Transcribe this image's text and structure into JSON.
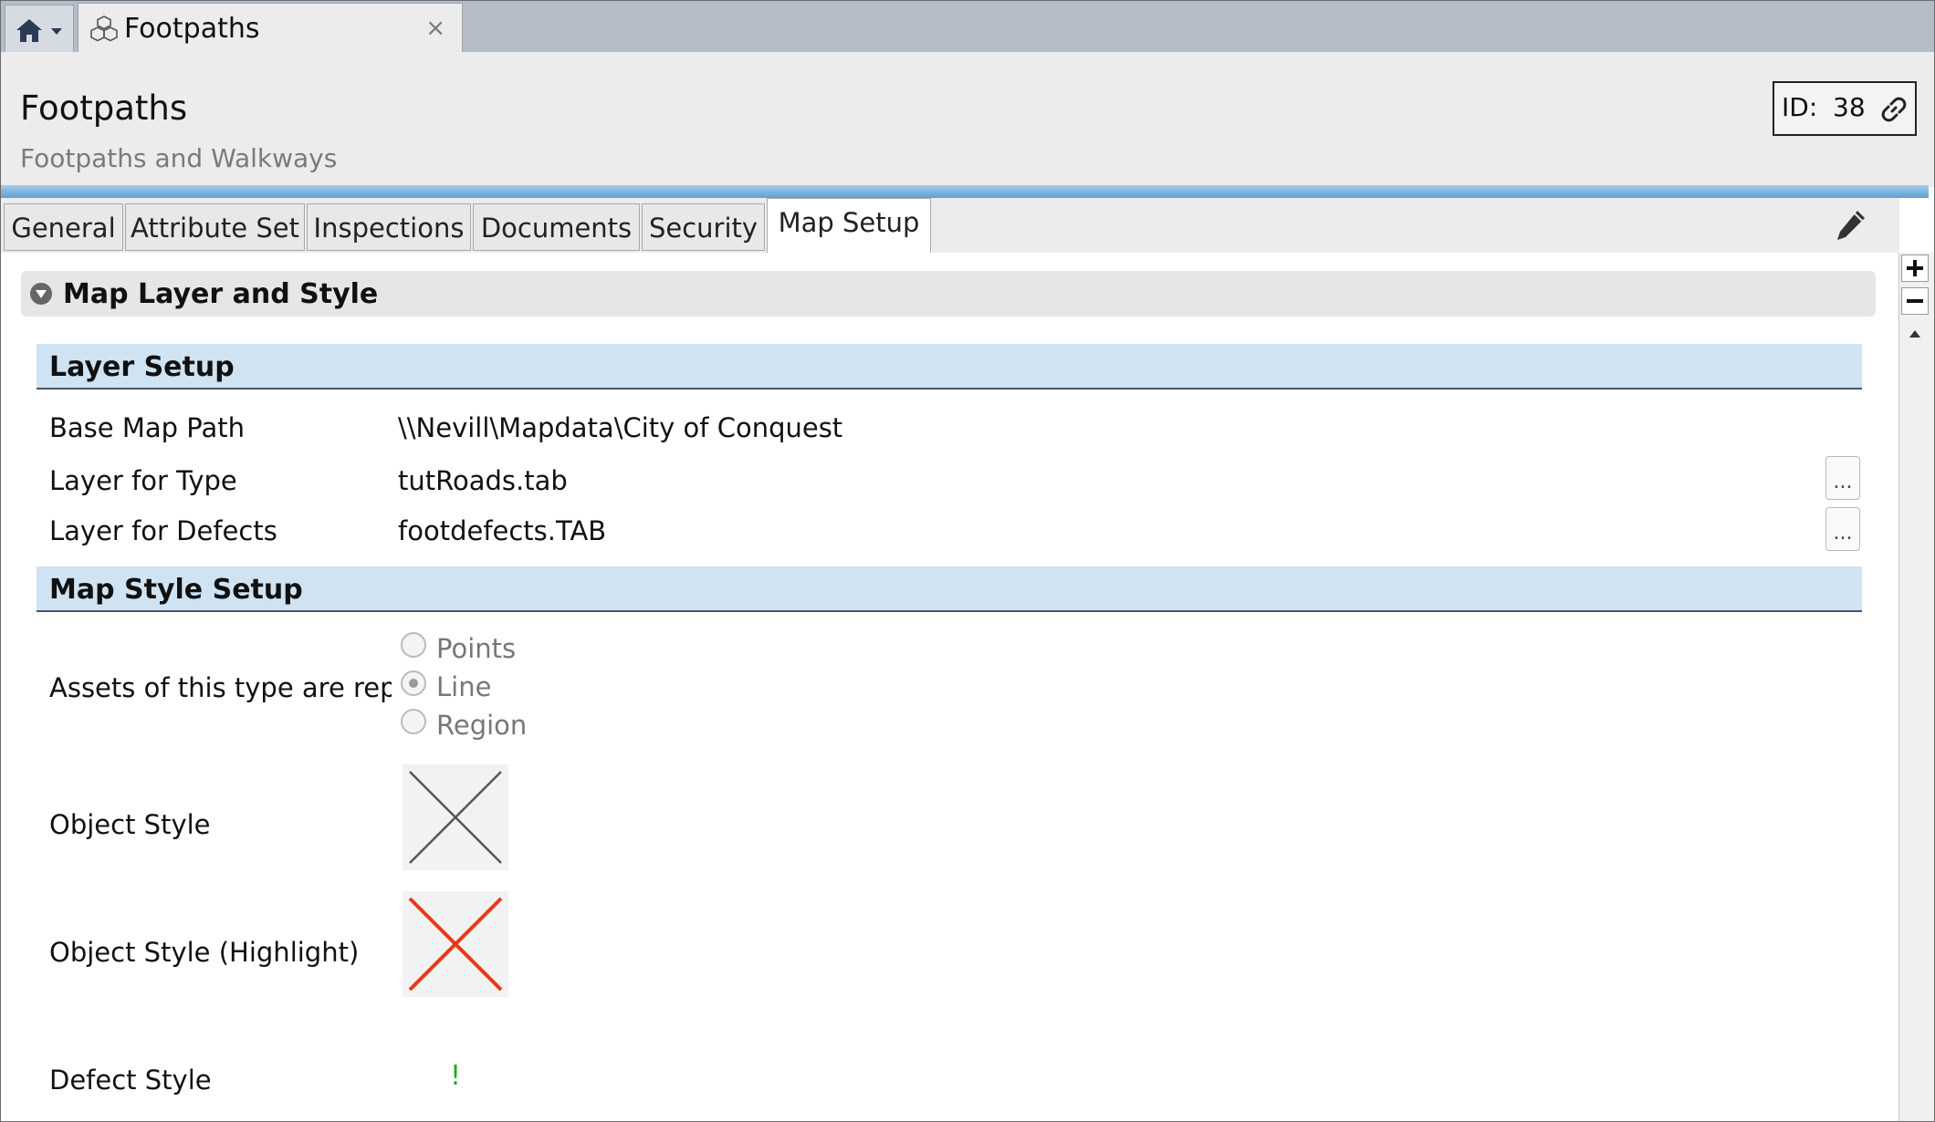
{
  "tab": {
    "title": "Footpaths",
    "close": "×",
    "home_icon": "home-icon",
    "type_icon": "cubes-icon"
  },
  "header": {
    "title": "Footpaths",
    "subtitle": "Footpaths and Walkways",
    "id_label": "ID:",
    "id_value": "38"
  },
  "subtabs": [
    "General",
    "Attribute Set",
    "Inspections",
    "Documents",
    "Security",
    "Map Setup"
  ],
  "active_subtab": "Map Setup",
  "section": {
    "title": "Map Layer and Style"
  },
  "layer_setup": {
    "title": "Layer Setup",
    "base_map_label": "Base Map Path",
    "base_map_value": "\\\\Nevill\\Mapdata\\City of Conquest",
    "layer_type_label": "Layer for Type",
    "layer_type_value": "tutRoads.tab",
    "layer_defects_label": "Layer for Defects",
    "layer_defects_value": "footdefects.TAB",
    "browse": "..."
  },
  "map_style": {
    "title": "Map Style Setup",
    "represented_label": "Assets of this type are repres",
    "options": [
      "Points",
      "Line",
      "Region"
    ],
    "selected": "Line",
    "object_style_label": "Object Style",
    "object_style_color": "#555555",
    "highlight_label": "Object Style (Highlight)",
    "highlight_color": "#e8391b",
    "defect_label": "Defect Style",
    "defect_symbol": "!",
    "defect_color": "#22aa22"
  }
}
